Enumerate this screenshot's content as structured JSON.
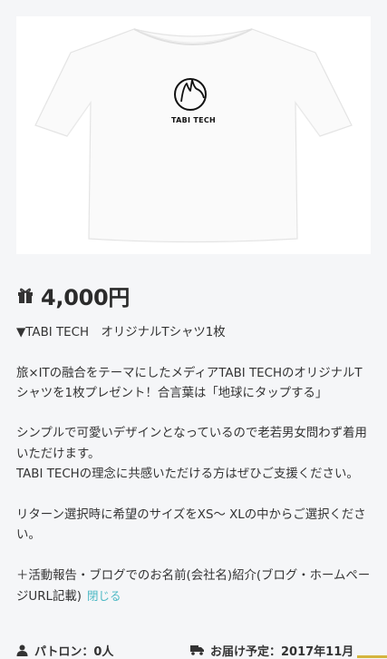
{
  "product": {
    "image_alt": "TABI TECH Tシャツ",
    "logo_text": "TABI TECH",
    "price": "4,000円"
  },
  "description": {
    "title": "▼TABI TECH　オリジナルTシャツ1枚",
    "para1": "旅×ITの融合をテーマにしたメディアTABI TECHのオリジナルTシャツを1枚プレゼント！合言葉は「地球にタップする」",
    "para2a": "シンプルで可愛いデザインとなっているので老若男女問わず着用いただけます。",
    "para2b": "TABI TECHの理念に共感いただける方はぜひご支援ください。",
    "para3": "リターン選択時に希望のサイズをXS〜 XLの中からご選択ください。",
    "para4": "＋活動報告・ブログでのお名前(会社名)紹介(ブログ・ホームページURL記載)",
    "close_label": "閉じる"
  },
  "footer": {
    "patron": "パトロン：0人",
    "delivery": "お届け予定：2017年11月"
  },
  "colors": {
    "background": "#f5f6f8",
    "link": "#4cb8c4",
    "accent": "#d4b53d"
  },
  "icons": {
    "price": "gift-icon",
    "patron": "person-icon",
    "delivery": "truck-icon"
  }
}
